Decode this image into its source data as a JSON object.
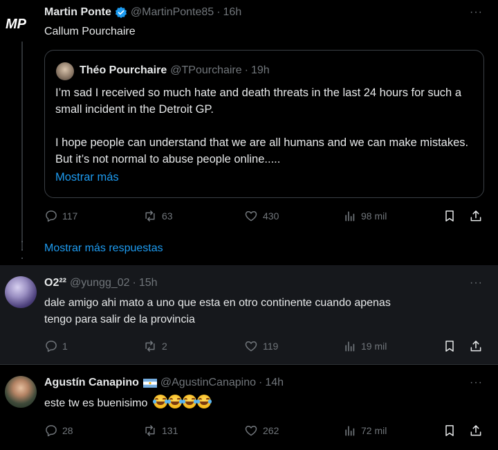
{
  "colors": {
    "background": "#000000",
    "highlight_background": "#16181c",
    "text": "#e7e9ea",
    "muted": "#71767b",
    "link": "#1d9bf0",
    "verified": "#1d9bf0",
    "border": "#2f3336"
  },
  "posts": [
    {
      "name": "Martin Ponte",
      "verified": true,
      "handle": "@MartinPonte85",
      "time": "16h",
      "text": "Callum Pourchaire",
      "avatar_text": "MP",
      "quote": {
        "name": "Théo Pourchaire",
        "handle": "@TPourchaire",
        "time": "19h",
        "paragraph1": "I’m sad I received so much hate and death threats in the last 24 hours for such a small incident in the Detroit GP.",
        "paragraph2": "I hope people can understand that we are all humans and we can make mistakes. But it’s not normal to abuse people online.....",
        "show_more": "Mostrar más"
      },
      "metrics": {
        "replies": "117",
        "reposts": "63",
        "likes": "430",
        "views": "98 mil"
      },
      "show_more_replies": "Mostrar más respuestas"
    },
    {
      "name": "O2²²",
      "handle": "@yungg_02",
      "time": "15h",
      "text_line1": "dale amigo ahi mato a uno que esta en otro continente cuando apenas",
      "text_line2": "tengo para salir de la provincia",
      "metrics": {
        "replies": "1",
        "reposts": "2",
        "likes": "119",
        "views": "19 mil"
      }
    },
    {
      "name": "Agustín Canapino",
      "flag": "argentina-flag",
      "handle": "@AgustinCanapino",
      "time": "14h",
      "text": "este tw es buenisimo",
      "emoji": [
        "rofl-emoji",
        "rofl-emoji",
        "rofl-emoji",
        "rofl-emoji"
      ],
      "metrics": {
        "replies": "28",
        "reposts": "131",
        "likes": "262",
        "views": "72 mil"
      }
    }
  ],
  "more_label": "···",
  "separator": "·"
}
